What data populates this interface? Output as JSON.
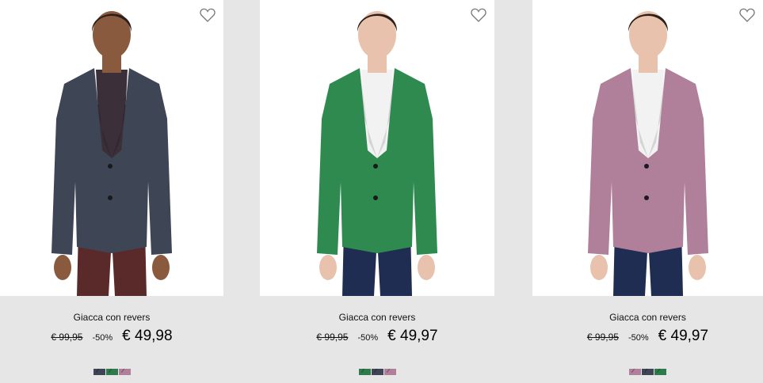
{
  "products": [
    {
      "name": "Giacca con revers",
      "old_price": "€ 99,95",
      "discount": "-50%",
      "price": "€ 49,98",
      "jacket_color": "#3e4656",
      "trouser_color": "#5a2a2a",
      "shirt_color": "#3b2f3a",
      "skin_color": "#8a5a3e",
      "swatches": [
        "#3e4656",
        "#2f7a4a",
        "#b07f9a"
      ]
    },
    {
      "name": "Giacca con revers",
      "old_price": "€ 99,95",
      "discount": "-50%",
      "price": "€ 49,97",
      "jacket_color": "#2e8a4e",
      "trouser_color": "#1f2d52",
      "shirt_color": "#f2f2f2",
      "skin_color": "#e8c2ad",
      "swatches": [
        "#2f7a4a",
        "#3e4656",
        "#b07f9a"
      ]
    },
    {
      "name": "Giacca con revers",
      "old_price": "€ 99,95",
      "discount": "-50%",
      "price": "€ 49,97",
      "jacket_color": "#b07f9a",
      "trouser_color": "#1f2d52",
      "shirt_color": "#f2f2f2",
      "skin_color": "#e8c2ad",
      "swatches": [
        "#b07f9a",
        "#3e4656",
        "#2f7a4a"
      ]
    }
  ]
}
